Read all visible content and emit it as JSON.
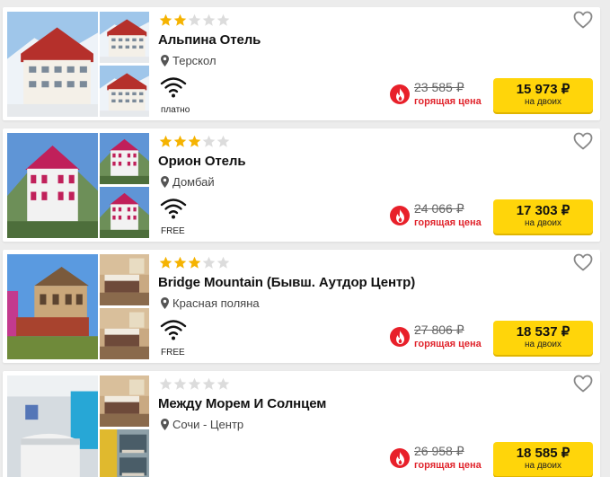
{
  "currency": "₽",
  "colors": {
    "accent_yellow": "#ffd50a",
    "hot_red": "#e8202a",
    "star_gold": "#f5b301",
    "star_empty": "#dcdcdc"
  },
  "hotels": [
    {
      "name": "Альпина Отель",
      "stars": 2,
      "location": "Терскол",
      "wifi_label": "платно",
      "old_price": "23 585 ₽",
      "hot_label": "горящая цена",
      "price": "15 973 ₽",
      "per": "на двоих",
      "photos": [
        "hotel-building-snow",
        "hotel-building-snow",
        "hotel-building-snow"
      ]
    },
    {
      "name": "Орион Отель",
      "stars": 3,
      "location": "Домбай",
      "wifi_label": "FREE",
      "old_price": "24 066 ₽",
      "hot_label": "горящая цена",
      "price": "17 303 ₽",
      "per": "на двоих",
      "photos": [
        "hotel-building-mountains",
        "hotel-building-mountains",
        "hotel-building-mountains"
      ]
    },
    {
      "name": "Bridge Mountain (Бывш. Аутдор Центр)",
      "stars": 3,
      "location": "Красная поляна",
      "wifi_label": "FREE",
      "old_price": "27 806 ₽",
      "hot_label": "горящая цена",
      "price": "18 537 ₽",
      "per": "на двоих",
      "photos": [
        "hotel-building-terrace",
        "hotel-room",
        "hotel-room"
      ]
    },
    {
      "name": "Между Морем И Солнцем",
      "stars": 0,
      "location": "Сочи - Центр",
      "wifi_label": "",
      "old_price": "26 958 ₽",
      "hot_label": "горящая цена",
      "price": "18 585 ₽",
      "per": "на двоих",
      "photos": [
        "hotel-reception",
        "hotel-room",
        "hotel-hostel-room"
      ]
    }
  ]
}
